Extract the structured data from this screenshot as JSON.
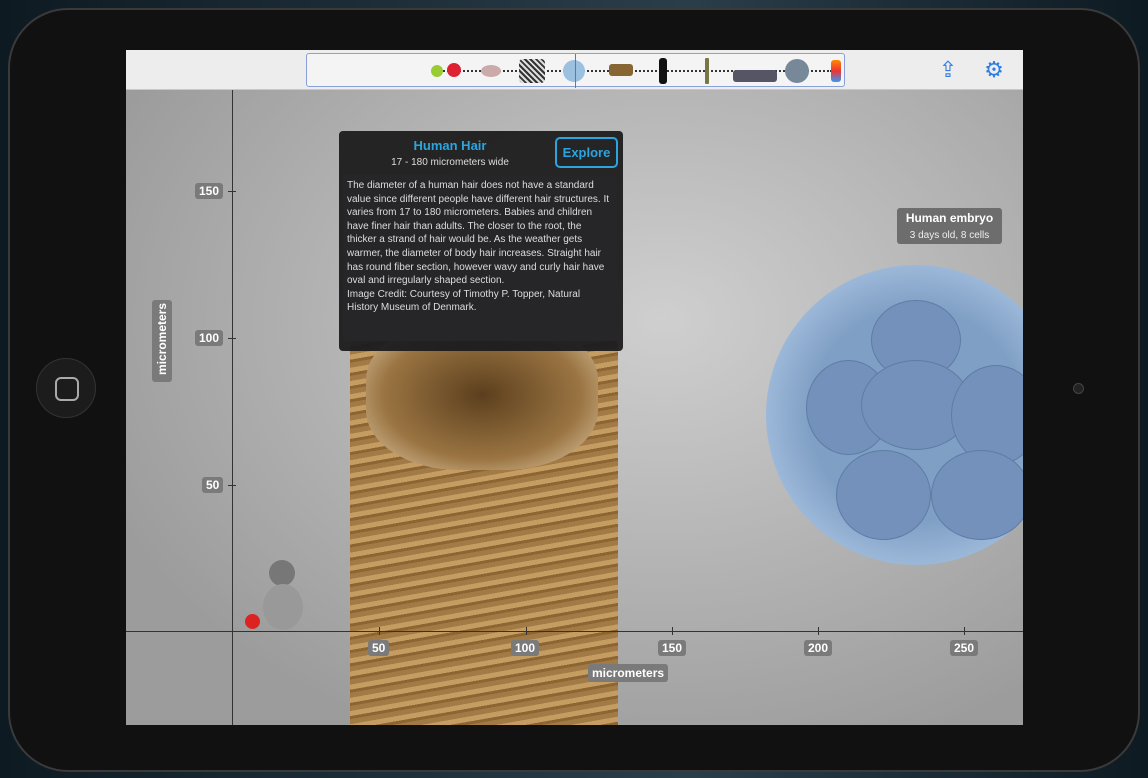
{
  "toolbar": {
    "share_icon": "share-icon",
    "settings_icon": "gear-icon"
  },
  "popup": {
    "title": "Human Hair",
    "subtitle": "17 - 180 micrometers wide",
    "explore_label": "Explore",
    "description": "The diameter of a human hair does not have a standard value since different people have different hair structures. It varies from 17 to 180 micrometers. Babies and children have finer hair than adults. The closer to the root, the thicker a strand of hair would be. As the weather gets warmer, the diameter of body hair increases. Straight hair has round fiber section, however wavy and curly hair have oval and irregularly shaped section.",
    "credit": "Image Credit: Courtesy of Timothy P. Topper, Natural History Museum of Denmark."
  },
  "embryo_label": {
    "title": "Human embryo",
    "subtitle": "3 days old, 8 cells"
  },
  "axes": {
    "y_label": "micrometers",
    "x_label": "micrometers",
    "y_ticks": [
      "150",
      "100",
      "50"
    ],
    "x_ticks": [
      "50",
      "100",
      "150",
      "200",
      "250"
    ]
  }
}
